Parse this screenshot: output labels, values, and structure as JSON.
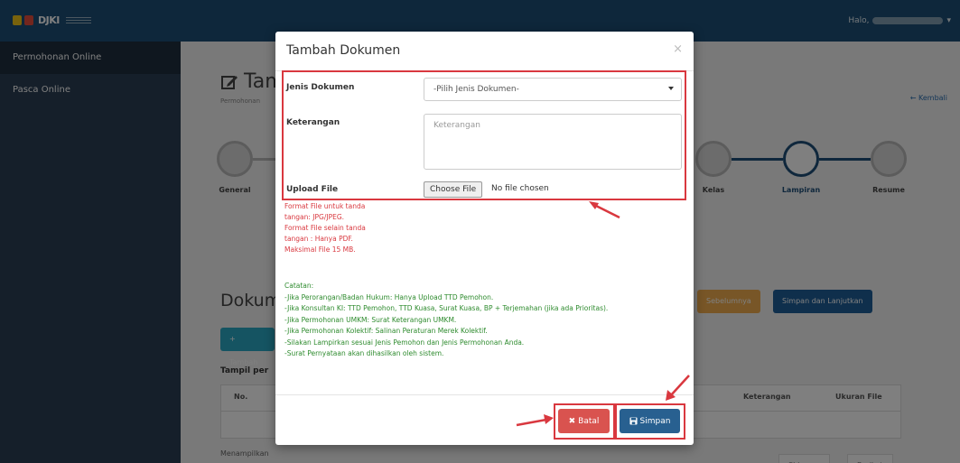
{
  "header": {
    "user_greeting": "Halo,"
  },
  "sidebar": {
    "items": [
      {
        "label": "Permohonan Online"
      },
      {
        "label": "Pasca Online"
      }
    ]
  },
  "page": {
    "title": "Tam",
    "subtitle": "Permohonan",
    "back_link": "Kembali"
  },
  "stepper": {
    "labels": [
      "General",
      "Kelas",
      "Lampiran",
      "Resume"
    ]
  },
  "documents": {
    "title": "Dokumen",
    "prev_button": "Sebelumnya",
    "next_button": "Simpan dan Lanjutkan",
    "add_button": "+ Tambah",
    "tampil_label": "Tampil per",
    "col_no": "No.",
    "col_keterangan": "Keterangan",
    "col_ukuran": "Ukuran File",
    "menampilkan": "Menampilkan",
    "pager_prev": "Sblmnya",
    "pager_next": "Berikut"
  },
  "modal": {
    "title": "Tambah Dokumen",
    "close_symbol": "×",
    "fields": {
      "jenis_label": "Jenis Dokumen",
      "jenis_placeholder": "-Pilih Jenis Dokumen-",
      "keterangan_label": "Keterangan",
      "keterangan_placeholder": "Keterangan",
      "upload_label": "Upload File",
      "choose_file": "Choose File",
      "no_file": "No file chosen"
    },
    "format_notes": [
      "Format File untuk tanda",
      "tangan: JPG/JPEG.",
      "Format File selain tanda",
      "tangan : Hanya PDF.",
      "Maksimal File 15 MB."
    ],
    "catatan_title": "Catatan:",
    "catatan_items": [
      "-Jika Perorangan/Badan Hukum: Hanya Upload TTD Pemohon.",
      "-Jika Konsultan KI: TTD Pemohon, TTD Kuasa, Surat Kuasa, BP + Terjemahan (jika ada Prioritas).",
      "-Jika Permohonan UMKM: Surat Keterangan UMKM.",
      "-Jika Permohonan Kolektif: Salinan Peraturan Merek Kolektif.",
      "-Silakan Lampirkan sesuai Jenis Pemohon dan Jenis Permohonan Anda.",
      "-Surat Pernyataan akan dihasilkan oleh sistem."
    ],
    "batal_label": "Batal",
    "simpan_label": "Simpan"
  },
  "colors": {
    "annotation": "#d9383f",
    "primary": "#286090",
    "danger": "#d9534f",
    "note_green": "#2e8b2e"
  }
}
